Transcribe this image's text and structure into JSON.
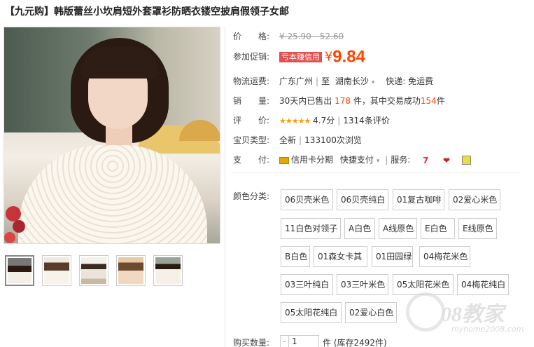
{
  "title": "【九元购】韩版蕾丝小坎肩短外套罩衫防晒衣镂空披肩假领子女邮",
  "price": {
    "label": "价　　格:",
    "value": "¥ 25.90 - 52.60"
  },
  "promo": {
    "label": "参加促销:",
    "badge": "亏本赚信用",
    "yen": "¥",
    "value": "9.84"
  },
  "shipping": {
    "label": "物流运费:",
    "from": "广东广州",
    "to_sep": "至",
    "to": "湖南长沙",
    "express": "快递: 免运费"
  },
  "sales": {
    "label": "销　　量:",
    "prefix": "30天内已售出",
    "count": "178",
    "mid": "件，其中交易成功",
    "success": "154",
    "suffix": "件"
  },
  "rating": {
    "label": "评　　价:",
    "stars": "★★★★★",
    "score": "4.7分",
    "reviews": "1314条评价"
  },
  "type": {
    "label": "宝贝类型:",
    "condition": "全新",
    "views": "133100次浏览"
  },
  "payment": {
    "label": "支　　付:",
    "credit": "信用卡分期",
    "quick": "快捷支付",
    "service_label": "服务:"
  },
  "colors": {
    "label": "颜色分类:",
    "options": [
      "06贝壳米色",
      "06贝壳纯白",
      "01复古咖啡",
      "02爱心米色",
      "11白色对领子",
      "A白色",
      "A线原色",
      "E白色",
      "E线原色",
      "B白色",
      "01森女卡其",
      "01田园绿",
      "04梅花米色",
      "03三叶纯白",
      "03三叶米色",
      "05太阳花米色",
      "04梅花纯白",
      "05太阳花纯白",
      "02爱心白色"
    ]
  },
  "quantity": {
    "label": "购买数量:",
    "minus": "-",
    "value": "1",
    "suffix": "件 (库存2492件)"
  },
  "watermark": {
    "big": "08教家",
    "small": "myhome2008.com"
  },
  "icons": {
    "zoom": "magnifier-icon",
    "credit": "credit-card-icon"
  },
  "accent": "#ff4400"
}
